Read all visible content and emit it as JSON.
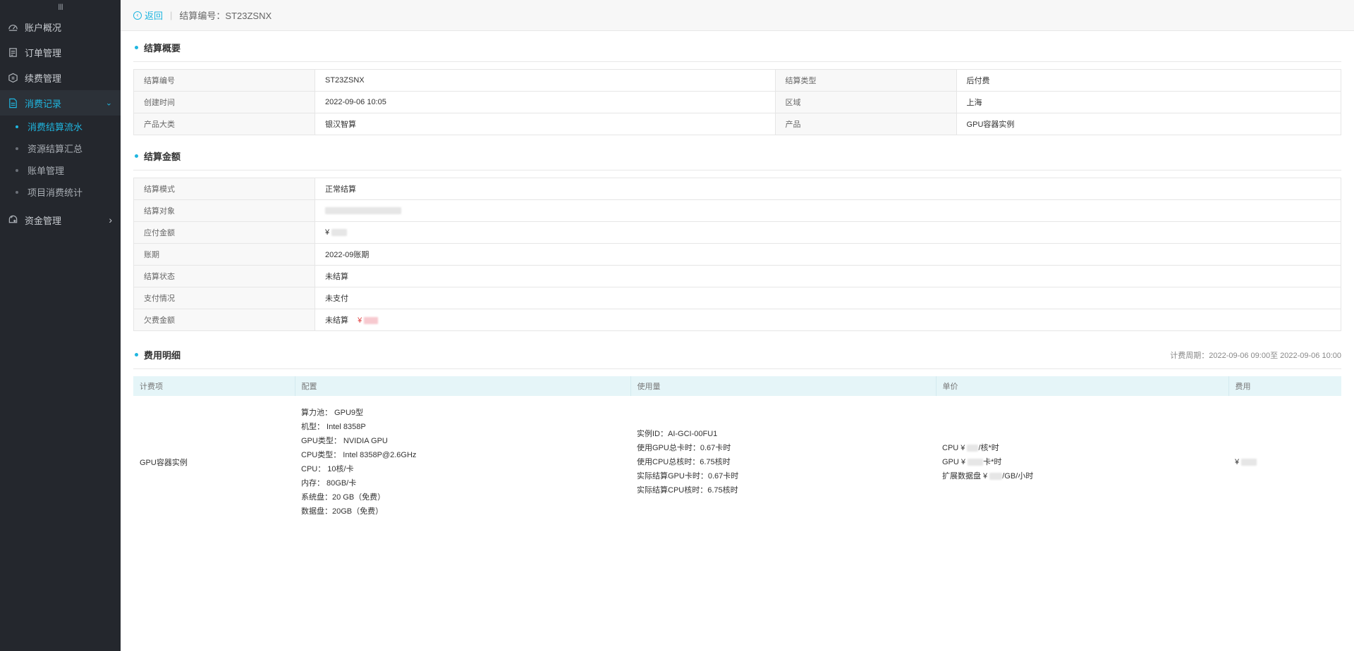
{
  "sidebar": {
    "collapse_glyph": "III",
    "items": [
      {
        "label": "账户概况",
        "icon": "dashboard-icon"
      },
      {
        "label": "订单管理",
        "icon": "order-icon"
      },
      {
        "label": "续费管理",
        "icon": "renew-icon"
      },
      {
        "label": "消费记录",
        "icon": "document-icon",
        "active": true,
        "chevron": "⌄"
      }
    ],
    "sub_items": [
      {
        "label": "消费结算流水",
        "active": true
      },
      {
        "label": "资源结算汇总"
      },
      {
        "label": "账单管理"
      },
      {
        "label": "项目消费统计"
      }
    ],
    "funds": {
      "label": "资金管理",
      "icon": "wallet-icon",
      "chevron": "›"
    }
  },
  "topbar": {
    "back_label": "返回",
    "separator": "|",
    "breadcrumb": "结算编号：ST23ZSNX"
  },
  "summary": {
    "title": "结算概要",
    "rows": [
      {
        "k1": "结算编号",
        "v1": "ST23ZSNX",
        "k2": "结算类型",
        "v2": "后付费"
      },
      {
        "k1": "创建时间",
        "v1": "2022-09-06 10:05",
        "k2": "区域",
        "v2": "上海"
      },
      {
        "k1": "产品大类",
        "v1": "银汉智算",
        "k2": "产品",
        "v2": "GPU容器实例"
      }
    ]
  },
  "amount": {
    "title": "结算金额",
    "mode_label": "结算模式",
    "mode_value": "正常结算",
    "target_label": "结算对象",
    "payable_label": "应付金额",
    "currency": "¥",
    "period_label": "账期",
    "period_value": "2022-09账期",
    "status_label": "结算状态",
    "status_value": "未结算",
    "payment_label": "支付情况",
    "payment_value": "未支付",
    "arrears_label": "欠费金额",
    "arrears_prefix": "未结算",
    "arrears_currency": "¥"
  },
  "detail": {
    "title": "费用明细",
    "period": "计费周期：2022-09-06 09:00至 2022-09-06 10:00",
    "headers": [
      "计费项",
      "配置",
      "使用量",
      "单价",
      "费用"
    ],
    "item": "GPU容器实例",
    "config": [
      "算力池： GPU9型",
      "机型： Intel 8358P",
      "GPU类型： NVIDIA GPU",
      "CPU类型： Intel 8358P@2.6GHz",
      "CPU： 10核/卡",
      "内存： 80GB/卡",
      "系统盘：20 GB（免费）",
      "数据盘：20GB（免费）"
    ],
    "usage": [
      "实例ID：AI-GCI-00FU1",
      "使用GPU总卡时：0.67卡时",
      "使用CPU总核时：6.75核时",
      "实际结算GPU卡时：0.67卡时",
      "实际结算CPU核时：6.75核时"
    ],
    "price": {
      "cpu_prefix": "CPU ¥",
      "cpu_suffix": "/核*时",
      "gpu_prefix": "GPU ¥",
      "gpu_suffix": "卡*时",
      "disk_prefix": "扩展数据盘 ¥",
      "disk_suffix": "/GB/小时"
    },
    "fee_currency": "¥"
  },
  "colors": {
    "accent": "#1fb6e0",
    "sidebar_bg": "#24272d",
    "danger": "#e03c3c"
  }
}
